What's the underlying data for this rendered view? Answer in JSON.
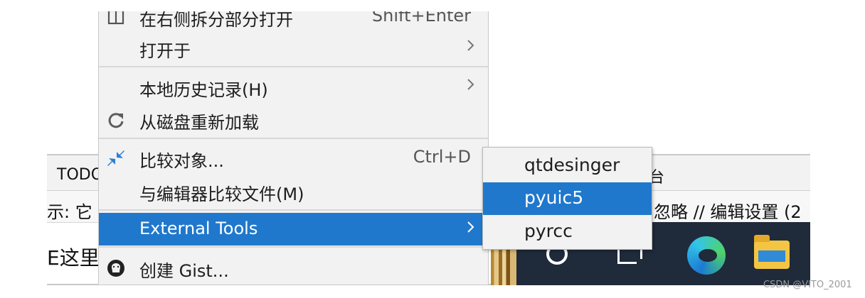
{
  "background": {
    "tabbar_left": "TODO",
    "tabbar_right": "台",
    "statusbar_left": "示: 它",
    "statusbar_right": "忽略 // 编辑设置 (2",
    "editor_text": "E这里"
  },
  "context_menu": {
    "items": [
      {
        "label": "在右侧拆分部分打开",
        "shortcut": "Shift+Enter",
        "icon": "split-right-icon"
      },
      {
        "label": "打开于",
        "submenu": true
      },
      {
        "label": "本地历史记录(H)",
        "mnemonic": "H",
        "submenu": true
      },
      {
        "label": "从磁盘重新加载",
        "icon": "reload-icon"
      },
      {
        "label": "比较对象...",
        "shortcut": "Ctrl+D",
        "icon": "compare-arrows-icon"
      },
      {
        "label": "与编辑器比较文件(M)",
        "mnemonic": "M"
      },
      {
        "label": "External Tools",
        "submenu": true,
        "selected": true
      },
      {
        "label": "创建 Gist...",
        "icon": "github-icon"
      }
    ]
  },
  "external_tools_submenu": {
    "items": [
      {
        "label": "qtdesinger"
      },
      {
        "label": "pyuic5",
        "selected": true
      },
      {
        "label": "pyrcc"
      }
    ]
  },
  "watermark": "CSDN @VITO_2001",
  "colors": {
    "selection": "#1f78cc",
    "menu_background": "#f2f2f2",
    "taskbar": "#1f2a3a"
  }
}
